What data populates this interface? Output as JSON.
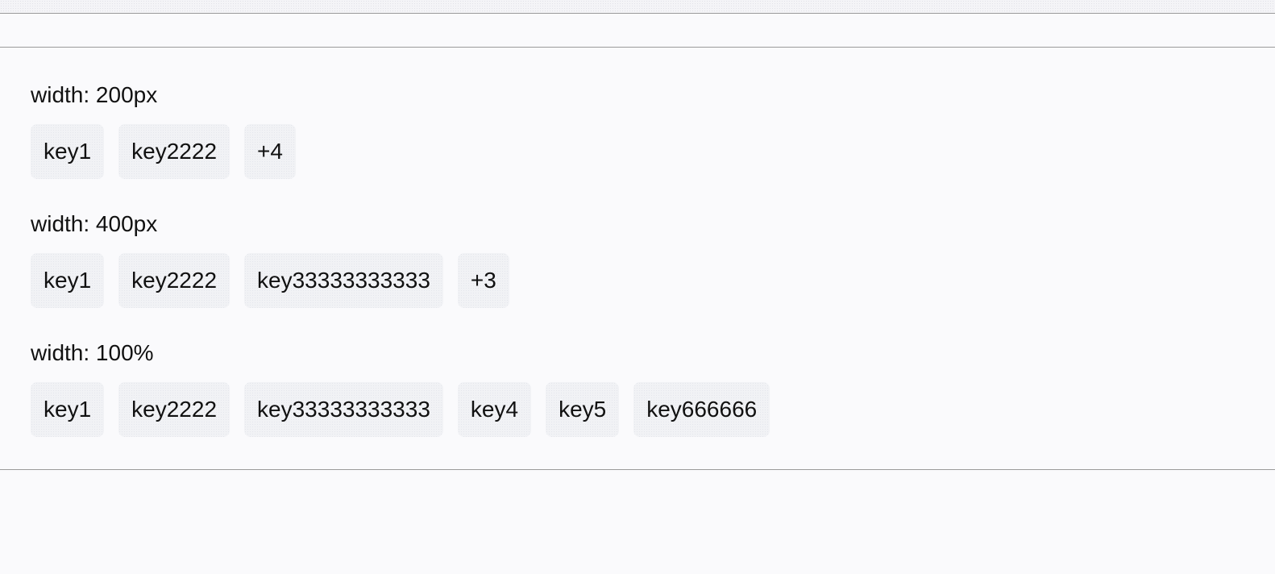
{
  "sections": [
    {
      "label": "width: 200px",
      "tags": [
        "key1",
        "key2222"
      ],
      "overflow": "+4"
    },
    {
      "label": "width: 400px",
      "tags": [
        "key1",
        "key2222",
        "key33333333333"
      ],
      "overflow": "+3"
    },
    {
      "label": "width: 100%",
      "tags": [
        "key1",
        "key2222",
        "key33333333333",
        "key4",
        "key5",
        "key666666"
      ],
      "overflow": ""
    }
  ],
  "colors": {
    "background": "#fafafc",
    "tag_background": "#f1f2f5",
    "divider": "#9a9a9a",
    "text": "#111111"
  }
}
